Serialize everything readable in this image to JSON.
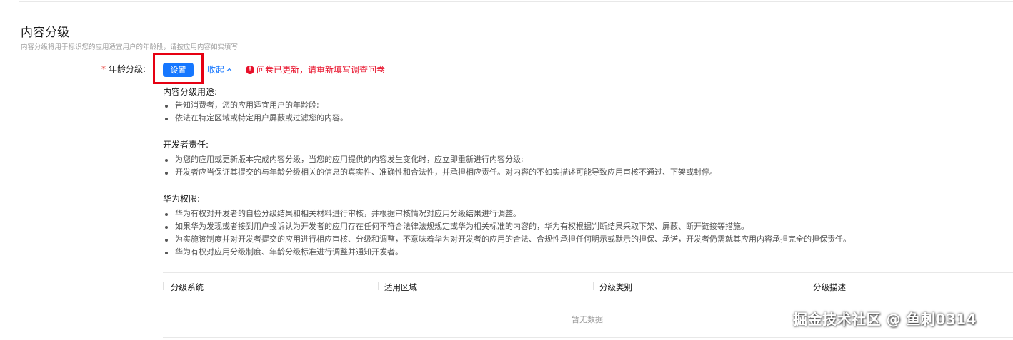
{
  "section": {
    "title": "内容分级",
    "description": "内容分级将用于标识您的应用适宜用户的年龄段，请按应用内容如实填写"
  },
  "age_rating": {
    "required_mark": "*",
    "label": "年龄分级:",
    "set_button": "设置",
    "collapse_link": "收起",
    "warning": "问卷已更新，请重新填写调查问卷"
  },
  "blocks": [
    {
      "title": "内容分级用途:",
      "items": [
        "告知消费者，您的应用适宜用户的年龄段;",
        "依法在特定区域或特定用户屏蔽或过滤您的内容。"
      ]
    },
    {
      "title": "开发者责任:",
      "items": [
        "为您的应用或更新版本完成内容分级，当您的应用提供的内容发生变化时，应立即重新进行内容分级;",
        "开发者应当保证其提交的与年龄分级相关的信息的真实性、准确性和合法性，并承担相应责任。对内容的不如实描述可能导致应用审核不通过、下架或封停。"
      ]
    },
    {
      "title": "华为权限:",
      "items": [
        "华为有权对开发者的自检分级结果和相关材料进行审核，并根据审核情况对应用分级结果进行调整。",
        "如果华为发现或者接到用户投诉认为开发者的应用存在任何不符合法律法规规定或华为相关标准的内容的，华为有权根据判断结果采取下架、屏蔽、断开链接等措施。",
        "为实施该制度并对开发者提交的应用进行相应审核、分级和调整，不意味着华为对开发者的应用的合法、合规性承担任何明示或默示的担保、承诺，开发者仍需就其应用内容承担完全的担保责任。",
        "华为有权对应用分级制度、年龄分级标准进行调整并通知开发者。"
      ]
    }
  ],
  "table": {
    "columns": [
      "分级系统",
      "适用区域",
      "分级类别",
      "分级描述"
    ],
    "empty_text": "暂无数据"
  },
  "watermark": "掘金技术社区 @ 鱼刺0314",
  "colors": {
    "primary": "#1677ff",
    "danger": "#e8102a",
    "highlight_box": "#e60012"
  },
  "icons": {
    "collapse": "chevron-up-icon",
    "warning": "exclamation-circle-icon"
  }
}
